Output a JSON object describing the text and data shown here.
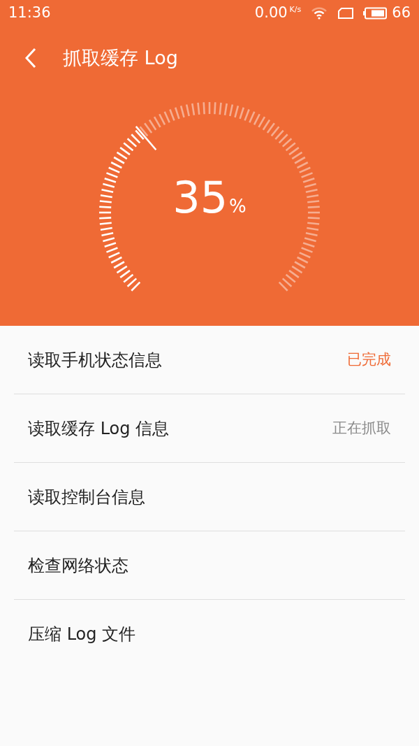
{
  "status_bar": {
    "time": "11:36",
    "net_speed": "0.00",
    "net_unit": "K/s",
    "battery": "66"
  },
  "title_bar": {
    "title": "抓取缓存 Log"
  },
  "progress": {
    "value": "35",
    "unit": "%"
  },
  "steps": [
    {
      "label": "读取手机状态信息",
      "kind": "done",
      "status": "已完成"
    },
    {
      "label": "读取缓存 Log 信息",
      "kind": "running",
      "status": "正在抓取"
    },
    {
      "label": "读取控制台信息",
      "kind": "pending"
    },
    {
      "label": "检查网络状态",
      "kind": "pending"
    },
    {
      "label": "压缩 Log 文件",
      "kind": "pending"
    }
  ]
}
